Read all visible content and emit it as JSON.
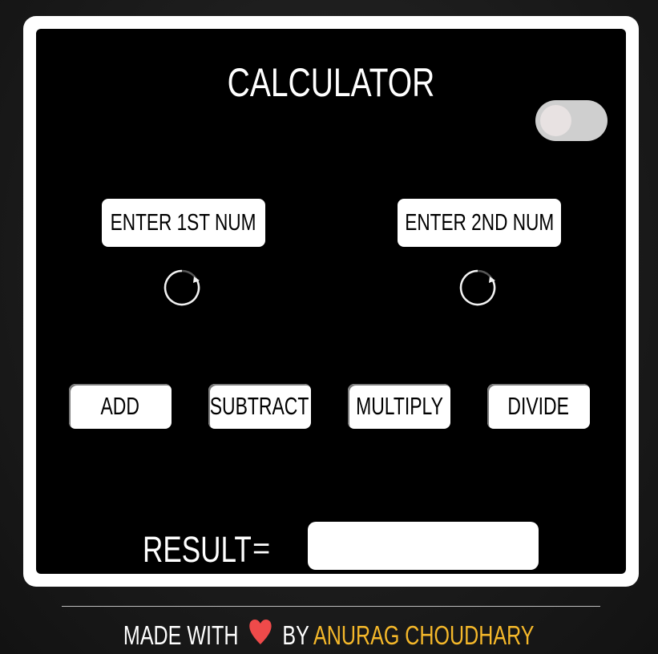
{
  "app": {
    "title": "CALCULATOR",
    "toggle": {
      "state": "off"
    }
  },
  "inputs": {
    "first_label": "ENTER 1ST NUM",
    "second_label": "ENTER 2ND NUM"
  },
  "operations": {
    "add": "ADD",
    "subtract": "SUBTRACT",
    "multiply": "MULTIPLY",
    "divide": "DIVIDE"
  },
  "result": {
    "label": "RESULT",
    "equals": "=",
    "value": ""
  },
  "footer": {
    "made_with": "MADE WITH",
    "by": "BY",
    "author": "ANURAG CHOUDHARY",
    "heart_icon": "heart-icon"
  },
  "colors": {
    "background": "#1c1c1c",
    "panel": "#000000",
    "frame": "#ffffff",
    "author": "#f5b82a",
    "heart": "#ef4a4a"
  }
}
